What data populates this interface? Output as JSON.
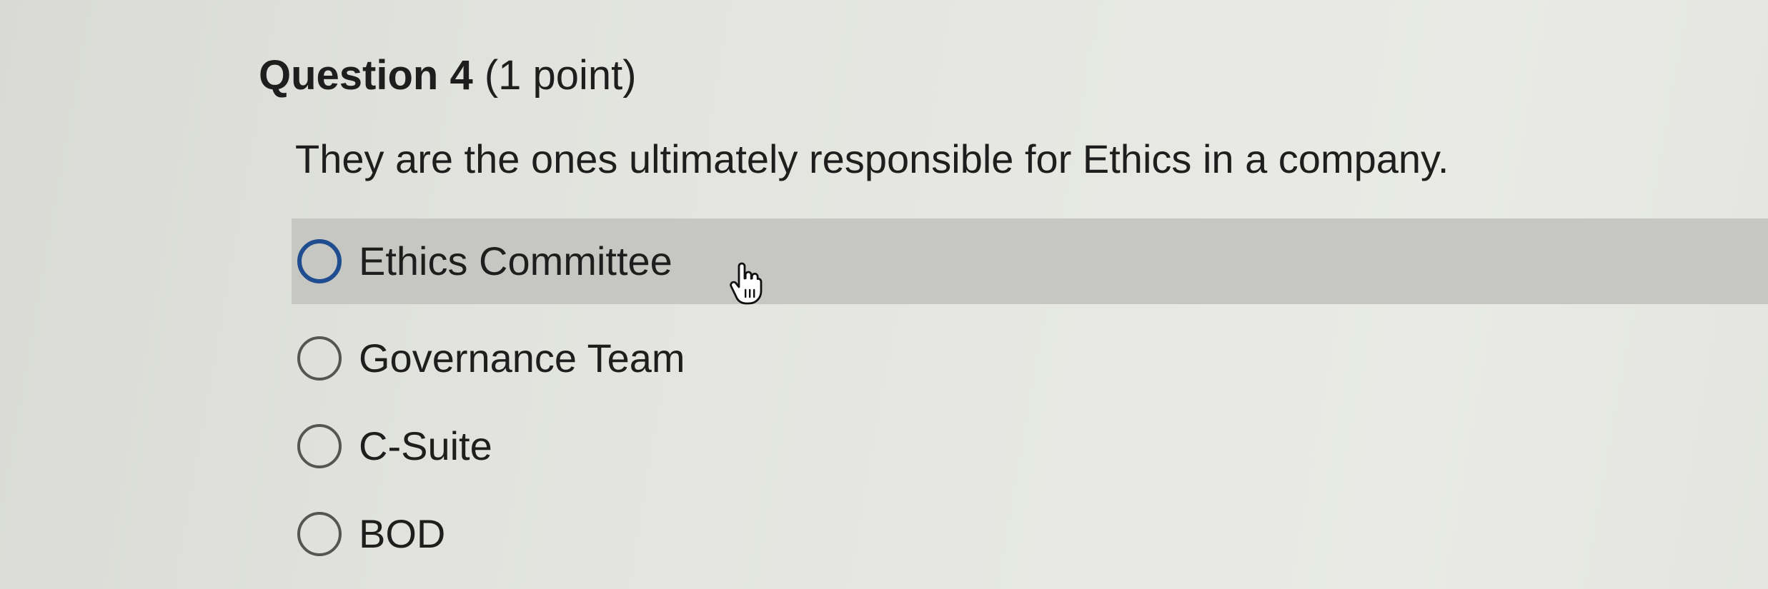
{
  "question": {
    "title": "Question 4",
    "points": "(1 point)",
    "prompt": "They are the ones ultimately responsible for Ethics in a company."
  },
  "options": [
    {
      "label": "Ethics Committee",
      "hovered": true
    },
    {
      "label": "Governance Team",
      "hovered": false
    },
    {
      "label": "C-Suite",
      "hovered": false
    },
    {
      "label": "BOD",
      "hovered": false
    }
  ],
  "colors": {
    "hover_row": "#c6c7c3",
    "radio_hover_border": "#1f4d8f",
    "radio_border": "#555555",
    "text": "#1e1e1e"
  },
  "icons": {
    "cursor": "hand-pointer-icon"
  }
}
